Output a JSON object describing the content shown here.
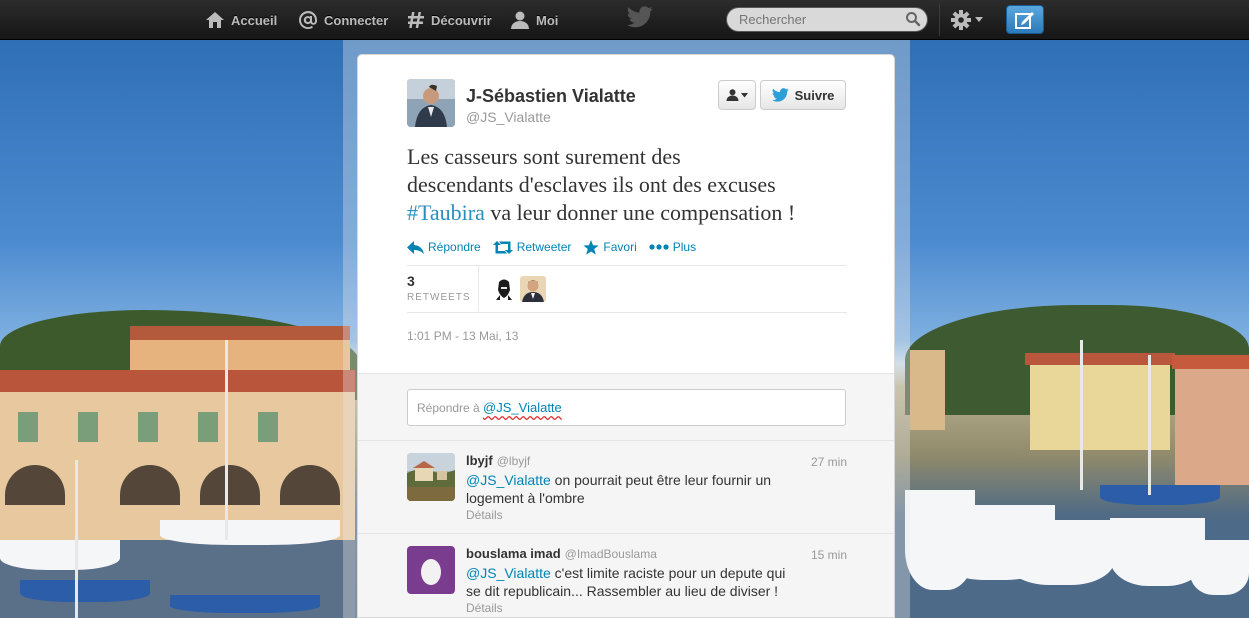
{
  "nav": {
    "home": "Accueil",
    "connect": "Connecter",
    "discover": "Découvrir",
    "me": "Moi",
    "search_placeholder": "Rechercher"
  },
  "tweet": {
    "fullname": "J-Sébastien Vialatte",
    "username": "@JS_Vialatte",
    "follow_label": "Suivre",
    "text_line1": "Les casseurs sont surement des",
    "text_line2": "descendants d'esclaves ils ont des excuses",
    "hashtag": "#Taubira",
    "text_line3_rest": " va leur donner une compensation !",
    "actions": {
      "reply": "Répondre",
      "retweet": "Retweeter",
      "favorite": "Favori",
      "more": "Plus"
    },
    "retweet_count": "3",
    "retweet_label": "RETWEETS",
    "timestamp": "1:01 PM - 13 Mai, 13"
  },
  "reply_box": {
    "prefix": "Répondre à ",
    "mention": "@JS_Vialatte"
  },
  "replies": [
    {
      "name": "lbyjf",
      "handle": "@lbyjf",
      "time": "27 min",
      "mention": "@JS_Vialatte",
      "text_rest": " on pourrait peut être leur fournir un logement à l'ombre",
      "details": "Détails"
    },
    {
      "name": "bouslama imad",
      "handle": "@ImadBouslama",
      "time": "15 min",
      "mention": "@JS_Vialatte",
      "text_rest": " c'est limite raciste pour un depute qui se dit republicain... Rassembler au lieu de diviser !",
      "details": "Détails"
    }
  ],
  "colors": {
    "link": "#0084b4",
    "hashtag": "#2a8fbd",
    "topbar": "#1e1e1e",
    "compose": "#2b7bb9"
  },
  "icons": [
    "home-icon",
    "at-icon",
    "hash-icon",
    "person-icon",
    "twitter-bird-icon",
    "search-icon",
    "gear-icon",
    "compose-icon",
    "reply-icon",
    "retweet-icon",
    "star-icon",
    "more-icon"
  ]
}
